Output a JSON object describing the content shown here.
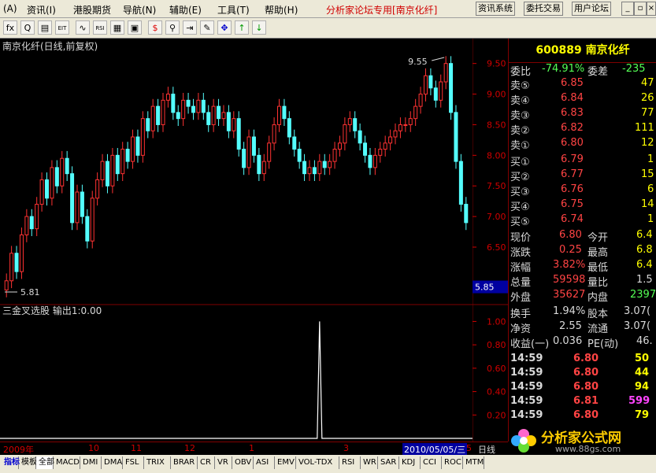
{
  "menu": {
    "items": [
      "(A)",
      "资讯(I)",
      "港股期货",
      "导航(N)",
      "辅助(E)",
      "工具(T)",
      "帮助(H)"
    ],
    "forum": "分析家论坛专用[南京化纤]",
    "buttons": [
      "资讯系统",
      "委托交易",
      "用户论坛"
    ]
  },
  "toolbar": {
    "icons": [
      {
        "name": "fx-icon",
        "glyph": "fx"
      },
      {
        "name": "zoom-icon",
        "glyph": "Q"
      },
      {
        "name": "chart-icon",
        "glyph": "▤"
      },
      {
        "name": "eit-icon",
        "glyph": "EIT"
      },
      {
        "name": "wave-icon",
        "glyph": "∿"
      },
      {
        "name": "rsi-icon",
        "glyph": "RSI"
      },
      {
        "name": "grid-icon",
        "glyph": "▦"
      },
      {
        "name": "window-icon",
        "glyph": "▣"
      },
      {
        "name": "dollar-icon",
        "glyph": "$"
      },
      {
        "name": "link-icon",
        "glyph": "⚲"
      },
      {
        "name": "login-icon",
        "glyph": "⇥"
      },
      {
        "name": "pencil-icon",
        "glyph": "✎"
      },
      {
        "name": "move-icon",
        "glyph": "✥"
      },
      {
        "name": "arrow-up-icon",
        "glyph": "↑"
      },
      {
        "name": "arrow-down-icon",
        "glyph": "↓"
      }
    ]
  },
  "colors": {
    "up": "#ff3232",
    "down": "#54ffff",
    "axis": "#d00000",
    "panelText": "#d9d9d9"
  },
  "chart_data": {
    "type": "candlestick",
    "title": "南京化纤(日线,前复权)",
    "high_label": "9.55",
    "low_label": "5.81",
    "current_price_box": "5.85",
    "yticks": [
      9.5,
      9.0,
      8.5,
      8.0,
      7.5,
      7.0,
      6.5
    ],
    "ylim": [
      5.6,
      9.65
    ],
    "close": [
      5.95,
      6.4,
      6.1,
      6.7,
      7.0,
      6.8,
      7.2,
      7.6,
      7.3,
      7.8,
      7.5,
      7.95,
      7.7,
      6.9,
      7.4,
      7.0,
      6.6,
      7.3,
      7.6,
      7.9,
      7.5,
      8.0,
      7.7,
      8.1,
      7.9,
      8.3,
      8.0,
      8.6,
      8.4,
      8.8,
      8.5,
      8.9,
      9.0,
      8.7,
      8.6,
      8.9,
      8.8,
      8.7,
      8.9,
      8.7,
      8.5,
      8.8,
      8.6,
      8.7,
      8.4,
      8.6,
      8.1,
      7.8,
      8.3,
      8.0,
      7.7,
      7.9,
      8.2,
      8.5,
      8.8,
      8.6,
      8.3,
      8.1,
      7.9,
      7.7,
      7.8,
      7.7,
      7.9,
      7.8,
      7.9,
      8.1,
      8.2,
      8.5,
      8.6,
      8.4,
      8.2,
      8.0,
      7.8,
      8.0,
      8.1,
      8.2,
      8.3,
      8.4,
      8.5,
      8.5,
      8.6,
      8.8,
      9.0,
      9.3,
      9.1,
      8.9,
      9.2,
      9.5,
      8.7,
      7.9,
      7.2,
      6.9
    ],
    "indicator": {
      "title": "三金叉选股 输出1:0.00",
      "yticks": [
        1.0,
        0.8,
        0.6,
        0.4,
        0.2
      ],
      "ylim": [
        0,
        1.05
      ],
      "spike_index": 62,
      "spike_value": 1.0
    },
    "xaxis_labels": [
      "2009年",
      "10",
      "11",
      "12",
      "1",
      "3",
      "2010/05/05/三",
      "5"
    ],
    "footer_label": "日线"
  },
  "quote": {
    "code_name": "600889 南京化纤",
    "weibi_label": "委比",
    "weibi_value": "-74.91%",
    "weicha_label": "委差",
    "weicha_value": "-235",
    "asks": [
      {
        "label": "卖⑤",
        "price": "6.85",
        "vol": "47"
      },
      {
        "label": "卖④",
        "price": "6.84",
        "vol": "26"
      },
      {
        "label": "卖③",
        "price": "6.83",
        "vol": "77"
      },
      {
        "label": "卖②",
        "price": "6.82",
        "vol": "111"
      },
      {
        "label": "卖①",
        "price": "6.80",
        "vol": "12"
      }
    ],
    "bids": [
      {
        "label": "买①",
        "price": "6.79",
        "vol": "1"
      },
      {
        "label": "买②",
        "price": "6.77",
        "vol": "15"
      },
      {
        "label": "买③",
        "price": "6.76",
        "vol": "6"
      },
      {
        "label": "买④",
        "price": "6.75",
        "vol": "14"
      },
      {
        "label": "买⑤",
        "price": "6.74",
        "vol": "1"
      }
    ],
    "stats": [
      {
        "l1": "现价",
        "v1": "6.80",
        "l2": "今开",
        "v2": "6.4"
      },
      {
        "l1": "涨跌",
        "v1": "0.25",
        "l2": "最高",
        "v2": "6.8"
      },
      {
        "l1": "涨幅",
        "v1": "3.82%",
        "l2": "最低",
        "v2": "6.4"
      },
      {
        "l1": "总量",
        "v1": "59598",
        "l2": "量比",
        "v2": "1.5"
      },
      {
        "l1": "外盘",
        "v1": "35627",
        "l2": "内盘",
        "v2": "2397"
      }
    ],
    "fund": [
      {
        "l1": "换手",
        "v1": "1.94%",
        "l2": "股本",
        "v2": "3.07("
      },
      {
        "l1": "净资",
        "v1": "2.55",
        "l2": "流通",
        "v2": "3.07("
      },
      {
        "l1": "收益(一)",
        "v1": "0.036",
        "l2": "PE(动)",
        "v2": "46."
      }
    ],
    "ticks": [
      {
        "time": "14:59",
        "price": "6.80",
        "vol": "50",
        "color": "#ffff00"
      },
      {
        "time": "14:59",
        "price": "6.80",
        "vol": "44",
        "color": "#ffff00"
      },
      {
        "time": "14:59",
        "price": "6.80",
        "vol": "94",
        "color": "#ffff00"
      },
      {
        "time": "14:59",
        "price": "6.81",
        "vol": "599",
        "color": "#ff44ff"
      },
      {
        "time": "14:59",
        "price": "6.80",
        "vol": "79",
        "color": "#ffff00"
      }
    ]
  },
  "logo": {
    "text": "分析家公式网",
    "url": "www.88gs.com"
  },
  "bottom_tabs": [
    "指标",
    "模板",
    "全部",
    "MACD",
    "DMI",
    "DMA",
    "FSL",
    "TRIX",
    "BRAR",
    "CR",
    "VR",
    "OBV",
    "ASI",
    "EMV",
    "VOL-TDX",
    "RSI",
    "WR",
    "SAR",
    "KDJ",
    "CCI",
    "ROC",
    "MTM"
  ]
}
